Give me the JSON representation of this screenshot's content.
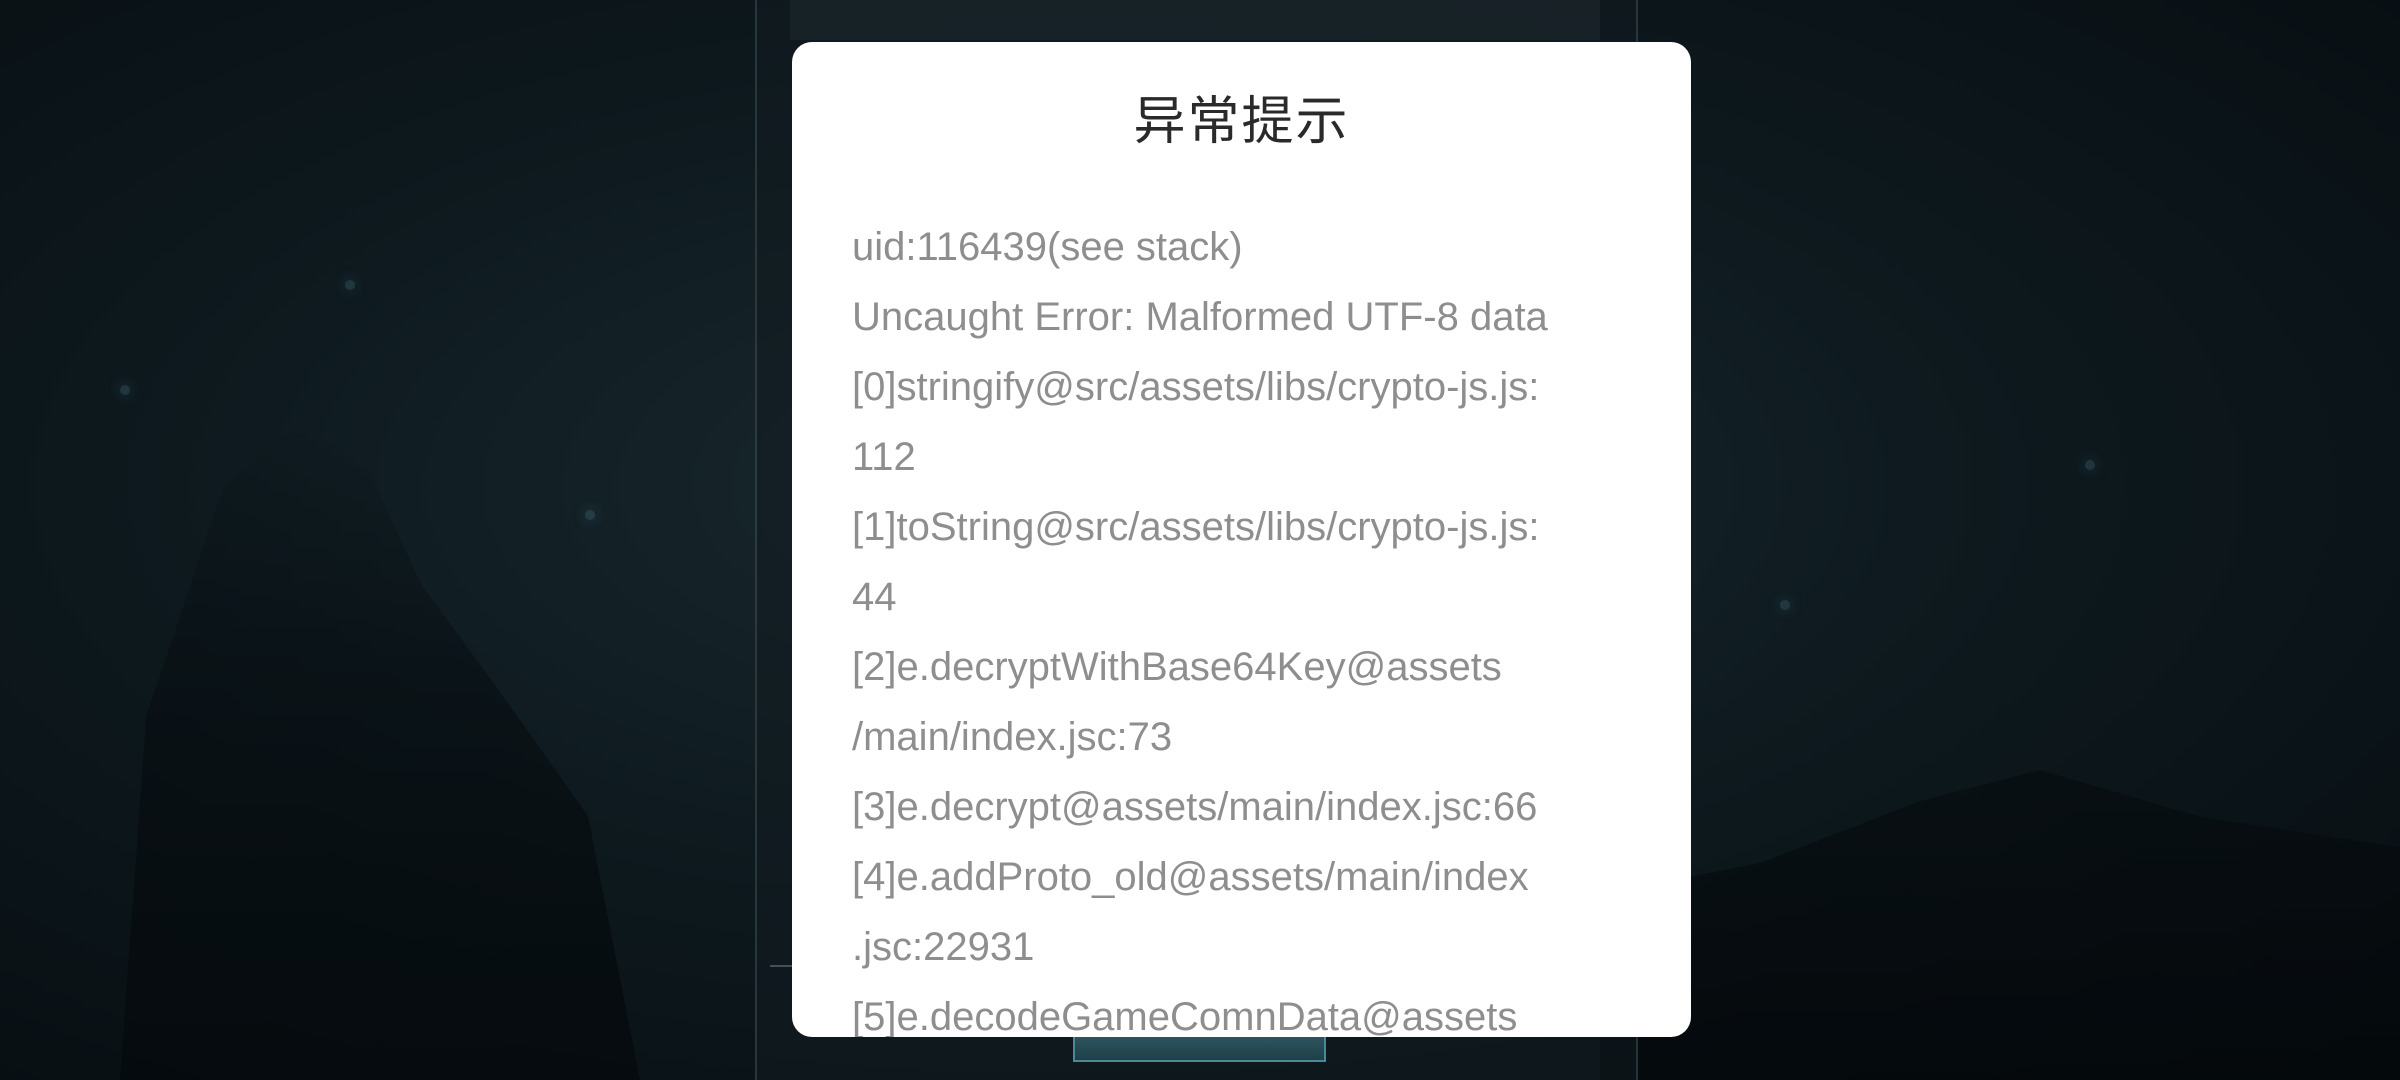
{
  "dialog": {
    "title": "异常提示",
    "lines": [
      "uid:116439(see stack)",
      "Uncaught Error: Malformed UTF-8 data",
      "[0]stringify@src/assets/libs/crypto-js.js:",
      "112",
      "[1]toString@src/assets/libs/crypto-js.js:",
      "44",
      "[2]e.decryptWithBase64Key@assets",
      "/main/index.jsc:73",
      "[3]e.decrypt@assets/main/index.jsc:66",
      "[4]e.addProto_old@assets/main/index",
      ".jsc:22931",
      "[5]e.decodeGameComnData@assets"
    ]
  }
}
